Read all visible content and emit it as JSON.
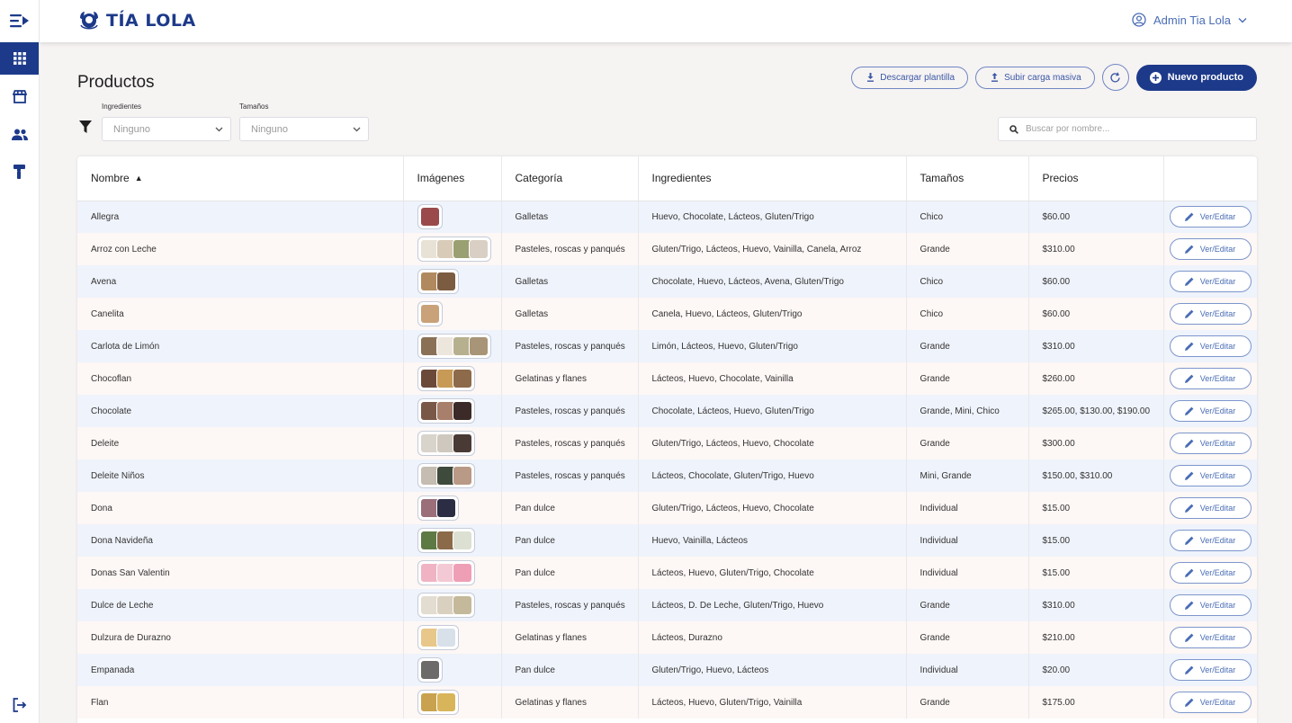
{
  "app": {
    "brand": "TÍA LOLA"
  },
  "user": {
    "name": "Admin Tia Lola"
  },
  "page": {
    "title": "Productos"
  },
  "actions": {
    "download_label": "Descargar plantilla",
    "upload_label": "Subir carga masiva",
    "new_label": "Nuevo producto"
  },
  "filters": {
    "ingredients_label": "Ingredientes",
    "ingredients_value": "Ninguno",
    "sizes_label": "Tamaños",
    "sizes_value": "Ninguno"
  },
  "search": {
    "placeholder": "Buscar por nombre..."
  },
  "table": {
    "columns": [
      "Nombre",
      "Imágenes",
      "Categoría",
      "Ingredientes",
      "Tamaños",
      "Precios",
      ""
    ],
    "edit_label": "Ver/Editar",
    "rows": [
      {
        "name": "Allegra",
        "images": [
          "#9a4a4a"
        ],
        "category": "Galletas",
        "ingredients": "Huevo, Chocolate, Lácteos, Gluten/Trigo",
        "sizes": "Chico",
        "prices": "$60.00"
      },
      {
        "name": "Arroz con Leche",
        "images": [
          "#e8e2d6",
          "#d8cbb8",
          "#9aa071",
          "#d9cfc4"
        ],
        "category": "Pasteles, roscas y panqués",
        "ingredients": "Gluten/Trigo, Lácteos, Huevo, Vainilla, Canela, Arroz",
        "sizes": "Grande",
        "prices": "$310.00"
      },
      {
        "name": "Avena",
        "images": [
          "#b08a5e",
          "#7b5c40"
        ],
        "category": "Galletas",
        "ingredients": "Chocolate, Huevo, Lácteos, Avena, Gluten/Trigo",
        "sizes": "Chico",
        "prices": "$60.00"
      },
      {
        "name": "Canelita",
        "images": [
          "#c9a27a"
        ],
        "category": "Galletas",
        "ingredients": "Canela, Huevo, Lácteos, Gluten/Trigo",
        "sizes": "Chico",
        "prices": "$60.00"
      },
      {
        "name": "Carlota de Limón",
        "images": [
          "#8a7055",
          "#ece6dd",
          "#b7b08e",
          "#a89476"
        ],
        "category": "Pasteles, roscas y panqués",
        "ingredients": "Limón, Lácteos, Huevo, Gluten/Trigo",
        "sizes": "Grande",
        "prices": "$310.00"
      },
      {
        "name": "Chocoflan",
        "images": [
          "#6b4a3a",
          "#c79a55",
          "#8d6a4a"
        ],
        "category": "Gelatinas y flanes",
        "ingredients": "Lácteos, Huevo, Chocolate, Vainilla",
        "sizes": "Grande",
        "prices": "$260.00"
      },
      {
        "name": "Chocolate",
        "images": [
          "#7a5848",
          "#a77f6a",
          "#3b2a27"
        ],
        "category": "Pasteles, roscas y panqués",
        "ingredients": "Chocolate, Lácteos, Huevo, Gluten/Trigo",
        "sizes": "Grande, Mini, Chico",
        "prices": "$265.00, $130.00, $190.00"
      },
      {
        "name": "Deleite",
        "images": [
          "#d8d4cc",
          "#cfc8be",
          "#4a3a35"
        ],
        "category": "Pasteles, roscas y panqués",
        "ingredients": "Gluten/Trigo, Lácteos, Huevo, Chocolate",
        "sizes": "Grande",
        "prices": "$300.00"
      },
      {
        "name": "Deleite Niños",
        "images": [
          "#c5bcb2",
          "#3e4a3c",
          "#b99a86"
        ],
        "category": "Pasteles, roscas y panqués",
        "ingredients": "Lácteos, Chocolate, Gluten/Trigo, Huevo",
        "sizes": "Mini, Grande",
        "prices": "$150.00, $310.00"
      },
      {
        "name": "Dona",
        "images": [
          "#9a6f7a",
          "#2b2d44"
        ],
        "category": "Pan dulce",
        "ingredients": "Gluten/Trigo, Lácteos, Huevo, Chocolate",
        "sizes": "Individual",
        "prices": "$15.00"
      },
      {
        "name": "Dona Navideña",
        "images": [
          "#5d7a45",
          "#8a6a48",
          "#dbe0d2"
        ],
        "category": "Pan dulce",
        "ingredients": "Huevo, Vainilla, Lácteos",
        "sizes": "Individual",
        "prices": "$15.00"
      },
      {
        "name": "Donas San Valentin",
        "images": [
          "#f0b3c3",
          "#f2c9d4",
          "#ee9fb6"
        ],
        "category": "Pan dulce",
        "ingredients": "Lácteos, Huevo, Gluten/Trigo, Chocolate",
        "sizes": "Individual",
        "prices": "$15.00"
      },
      {
        "name": "Dulce de Leche",
        "images": [
          "#e3dcd0",
          "#d9d0c0",
          "#c4b99a"
        ],
        "category": "Pasteles, roscas y panqués",
        "ingredients": "Lácteos, D. De Leche, Gluten/Trigo, Huevo",
        "sizes": "Grande",
        "prices": "$310.00"
      },
      {
        "name": "Dulzura de Durazno",
        "images": [
          "#e8c78a",
          "#d8e0ea"
        ],
        "category": "Gelatinas y flanes",
        "ingredients": "Lácteos, Durazno",
        "sizes": "Grande",
        "prices": "$210.00"
      },
      {
        "name": "Empanada",
        "images": [
          "#6d6a6a"
        ],
        "category": "Pan dulce",
        "ingredients": "Gluten/Trigo, Huevo, Lácteos",
        "sizes": "Individual",
        "prices": "$20.00"
      },
      {
        "name": "Flan",
        "images": [
          "#c9a24f",
          "#d8b55a"
        ],
        "category": "Gelatinas y flanes",
        "ingredients": "Lácteos, Huevo, Gluten/Trigo, Vainilla",
        "sizes": "Grande",
        "prices": "$175.00"
      }
    ]
  },
  "colors": {
    "primary": "#1d3a8a",
    "accent": "#4a6db5"
  }
}
